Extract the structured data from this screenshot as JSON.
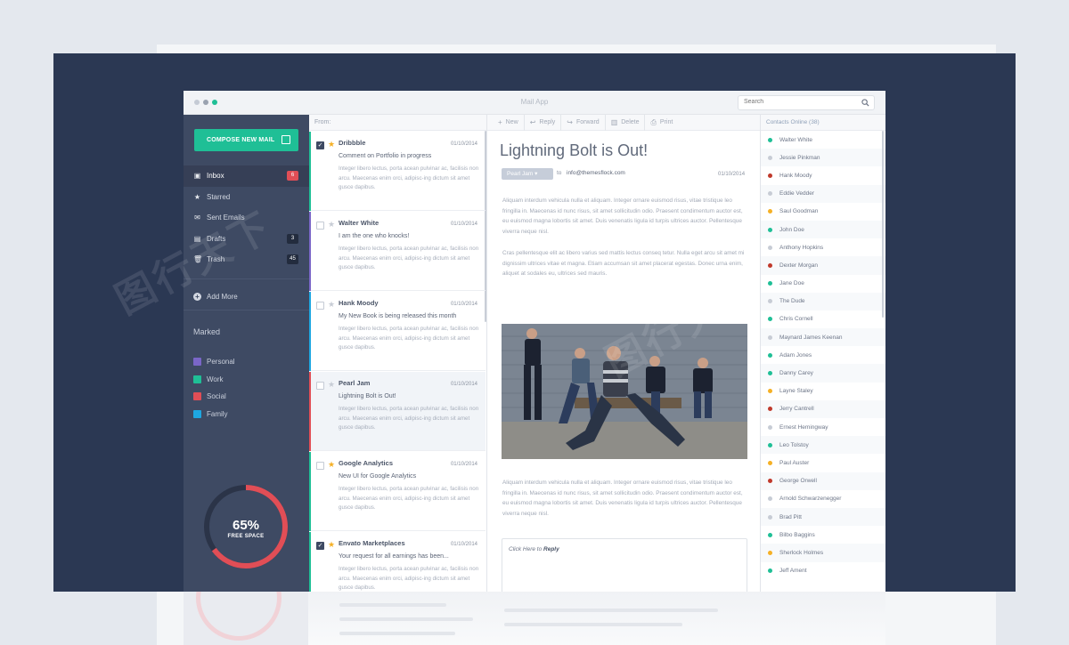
{
  "window": {
    "title": "Mail App",
    "search_placeholder": "Search"
  },
  "colors": {
    "accent": "#1fbf96",
    "sidebar": "#3e4a63",
    "stage": "#2b3853",
    "danger": "#e14e56"
  },
  "sidebar": {
    "compose_label": "COMPOSE NEW MAIL",
    "items": [
      {
        "label": "Inbox",
        "icon": "inbox-icon",
        "badge": "6"
      },
      {
        "label": "Starred",
        "icon": "star-icon",
        "badge": ""
      },
      {
        "label": "Sent Emails",
        "icon": "mail-icon",
        "badge": ""
      },
      {
        "label": "Drafts",
        "icon": "draft-icon",
        "badge": "3"
      },
      {
        "label": "Trash",
        "icon": "trash-icon",
        "badge": "45"
      }
    ],
    "add_more": "Add More",
    "marked_title": "Marked",
    "marked": [
      {
        "label": "Personal",
        "color": "#7a66c7"
      },
      {
        "label": "Work",
        "color": "#1fbf96"
      },
      {
        "label": "Social",
        "color": "#e14e56"
      },
      {
        "label": "Family",
        "color": "#1ea7e1"
      }
    ],
    "storage": {
      "percent_label": "65%",
      "caption": "FREE SPACE",
      "fraction": 0.65
    }
  },
  "list": {
    "header": "From:",
    "messages": [
      {
        "sender": "Dribbble",
        "date": "01/10/2014",
        "subject": "Comment on Portfolio in progress",
        "preview": "Integer libero lectus, porta acean pulvinar ac, facilisis non arcu. Maecenas enim orci, adipisc-ing dictum sit amet gusce dapibus.",
        "checked": true,
        "starred": true,
        "color": "#1fbf96"
      },
      {
        "sender": "Walter White",
        "date": "01/10/2014",
        "subject": "I am the one who knocks!",
        "preview": "Integer libero lectus, porta acean pulvinar ac, facilisis non arcu. Maecenas enim orci, adipisc-ing dictum sit amet gusce dapibus.",
        "checked": false,
        "starred": false,
        "color": "#7a66c7"
      },
      {
        "sender": "Hank Moody",
        "date": "01/10/2014",
        "subject": "My New Book is being released this month",
        "preview": "Integer libero lectus, porta acean pulvinar ac, facilisis non arcu. Maecenas enim orci, adipisc-ing dictum sit amet gusce dapibus.",
        "checked": false,
        "starred": false,
        "color": "#1ea7e1"
      },
      {
        "sender": "Pearl Jam",
        "date": "01/10/2014",
        "subject": "Lightning Bolt  is Out!",
        "preview": "Integer libero lectus, porta acean pulvinar ac, facilisis non arcu. Maecenas enim orci, adipisc-ing dictum sit amet gusce dapibus.",
        "checked": false,
        "starred": false,
        "color": "#e14e56"
      },
      {
        "sender": "Google Analytics",
        "date": "01/10/2014",
        "subject": "New UI for Google Analytics",
        "preview": "Integer libero lectus, porta acean pulvinar ac, facilisis non arcu. Maecenas enim orci, adipisc-ing dictum sit amet gusce dapibus.",
        "checked": false,
        "starred": true,
        "color": "#1fbf96"
      },
      {
        "sender": "Envato Marketplaces",
        "date": "01/10/2014",
        "subject": "Your request for all earnings has been...",
        "preview": "Integer libero lectus, porta acean pulvinar ac, facilisis non arcu. Maecenas enim orci, adipisc-ing dictum sit amet gusce dapibus.",
        "checked": true,
        "starred": true,
        "color": "#1fbf96"
      }
    ]
  },
  "toolbar": {
    "new": "New",
    "reply": "Reply",
    "forward": "Forward",
    "delete": "Delete",
    "print": "Print"
  },
  "reader": {
    "subject": "Lightning Bolt  is Out!",
    "from": "Pearl Jam",
    "to_label": "to",
    "to_email": "info@themesflock.com",
    "date": "01/10/2014",
    "para1": "Aliquam interdum vehicula nulla et aliquam. Integer ornare euismod risus, vitae tristique leo fringilla in. Maecenas id nunc risus, sit amet sollicitudin odio. Praesent condimentum auctor est, eu euismod magna lobortis sit amet. Duis venenatis ligula id turpis ultrices auctor. Pellentesque viverra neque nisl.",
    "para2": "Cras pellentesque elit ac libero varius sed mattis lectus conseq tetur. Nulla eget arcu sit amet mi dignissim ultrices vitae et magna. Etiam accumsan sit amet placerat egestas. Donec urna enim, aliquet at sodales eu, ultrices sed mauris.",
    "para3": "Aliquam interdum vehicula nulla et aliquam. Integer ornare euismod risus, vitae tristique leo fringilla in. Maecenas id nunc risus, sit amet sollicitudin odio. Praesent condimentum auctor est, eu euismod magna lobortis sit amet. Duis venenatis ligula id turpis ultrices auctor. Pellentesque viverra neque nisl.",
    "reply_prefix": "Click Here to ",
    "reply_action": "Reply"
  },
  "contacts": {
    "header": "Contacts Online (38)",
    "people": [
      {
        "name": "Walter White",
        "status": "#1fbf96"
      },
      {
        "name": "Jessie Pinkman",
        "status": "#c7ccd5"
      },
      {
        "name": "Hank Moody",
        "status": "#c0392b"
      },
      {
        "name": "Eddie Vedder",
        "status": "#c7ccd5"
      },
      {
        "name": "Saul Goodman",
        "status": "#f5b025"
      },
      {
        "name": "John Doe",
        "status": "#1fbf96"
      },
      {
        "name": "Anthony Hopkins",
        "status": "#c7ccd5"
      },
      {
        "name": "Dexter Morgan",
        "status": "#c0392b"
      },
      {
        "name": "Jane Doe",
        "status": "#1fbf96"
      },
      {
        "name": "The Dude",
        "status": "#c7ccd5"
      },
      {
        "name": "Chris Cornell",
        "status": "#1fbf96"
      },
      {
        "name": "Maynard James Keenan",
        "status": "#c7ccd5"
      },
      {
        "name": "Adam Jones",
        "status": "#1fbf96"
      },
      {
        "name": "Danny Carey",
        "status": "#1fbf96"
      },
      {
        "name": "Layne Staley",
        "status": "#f5b025"
      },
      {
        "name": "Jerry Cantrell",
        "status": "#c0392b"
      },
      {
        "name": "Ernest Hemingway",
        "status": "#c7ccd5"
      },
      {
        "name": "Leo Tolstoy",
        "status": "#1fbf96"
      },
      {
        "name": "Paul Auster",
        "status": "#f5b025"
      },
      {
        "name": "George Orwell",
        "status": "#c0392b"
      },
      {
        "name": "Arnold Schwarzenegger",
        "status": "#c7ccd5"
      },
      {
        "name": "Brad Pitt",
        "status": "#c7ccd5"
      },
      {
        "name": "Bilbo Baggins",
        "status": "#1fbf96"
      },
      {
        "name": "Sherlock Holmes",
        "status": "#f5b025"
      },
      {
        "name": "Jeff Ament",
        "status": "#1fbf96"
      }
    ]
  }
}
